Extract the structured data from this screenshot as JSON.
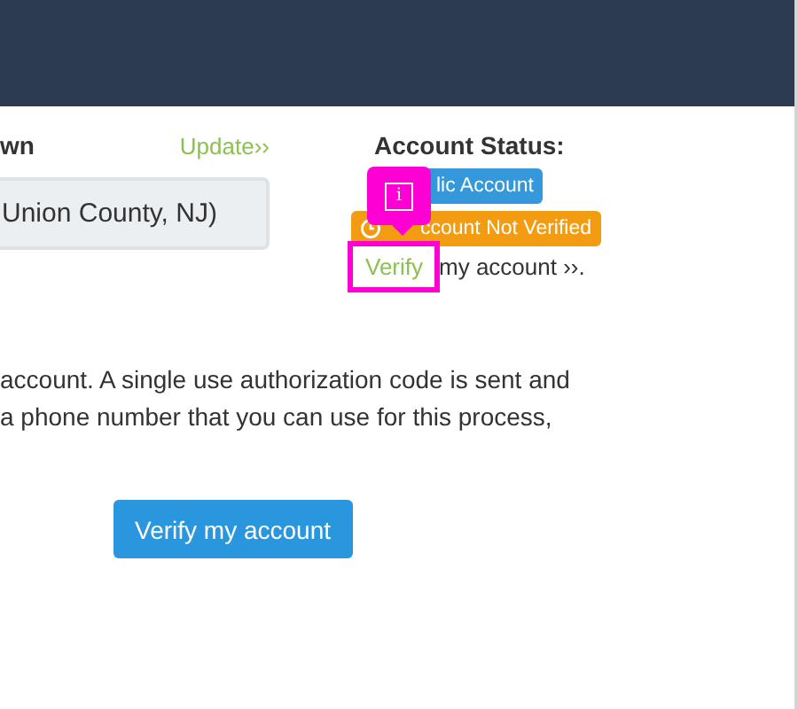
{
  "location": {
    "heading": "wn",
    "update_link": "Update››",
    "value": "Union County, NJ)"
  },
  "account_status": {
    "heading": "Account Status:",
    "badges": [
      {
        "text": "lic Account",
        "color": "#3498db",
        "kind": "plain"
      },
      {
        "text": "ccount Not Verified",
        "color": "#f39c12",
        "kind": "clock"
      }
    ],
    "verify_link": "Verify",
    "verify_rest": "my account ››."
  },
  "tour_marker": {
    "icon_text": "i"
  },
  "description": [
    "account. A single use authorization code is sent and",
    "a phone number that you can use for this process,"
  ],
  "button": "Verify my account"
}
